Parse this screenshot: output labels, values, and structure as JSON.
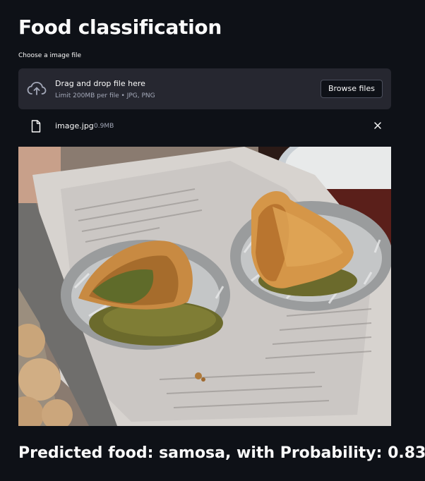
{
  "header": {
    "title": "Food classification"
  },
  "uploader": {
    "label": "Choose a image file",
    "dropzone_title": "Drag and drop file here",
    "dropzone_hint": "Limit 200MB per file • JPG, PNG",
    "browse_label": "Browse files",
    "icon": "cloud-upload-icon"
  },
  "file": {
    "name": "image.jpg",
    "size": "0.9MB",
    "icon": "file-icon",
    "remove_icon": "close-icon"
  },
  "result": {
    "text": "Predicted food: samosa, with Probability: 0.83"
  },
  "colors": {
    "background": "#0e1117",
    "panel": "#262730",
    "text": "#fafafa",
    "muted": "#a3a8b8"
  }
}
